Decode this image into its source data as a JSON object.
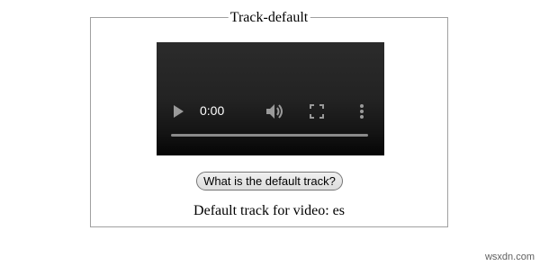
{
  "fieldset": {
    "legend": "Track-default"
  },
  "video": {
    "time": "0:00",
    "progress": 0,
    "icons": [
      "play-icon",
      "volume-icon",
      "fullscreen-icon",
      "more-options-icon"
    ]
  },
  "button": {
    "label": "What is the default track?"
  },
  "result": {
    "text": "Default track for video: es"
  },
  "watermark": "wsxdn.com"
}
